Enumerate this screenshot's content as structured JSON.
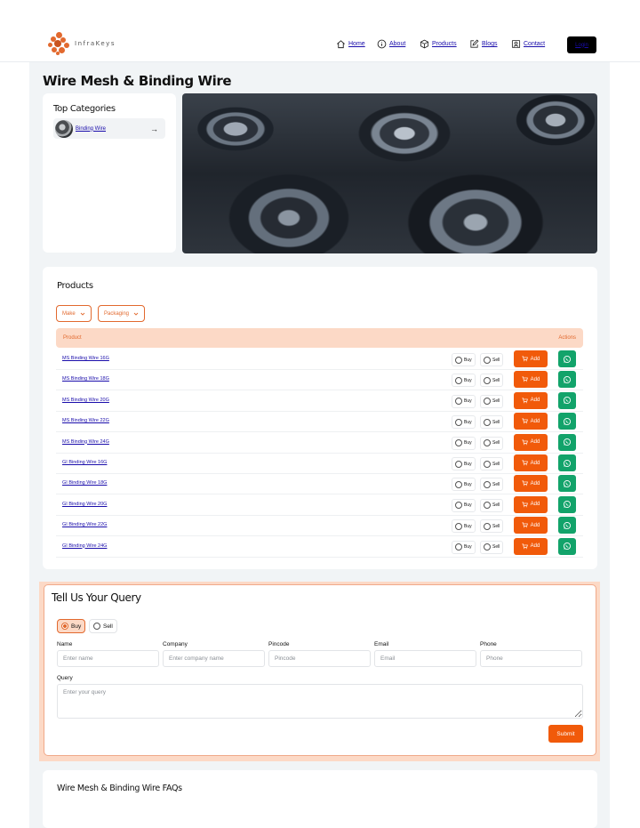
{
  "header": {
    "logo_text": "InfraKeys",
    "nav": [
      {
        "label": "Home",
        "icon": "home-icon"
      },
      {
        "label": "About",
        "icon": "info-icon"
      },
      {
        "label": "Products",
        "icon": "box-icon"
      },
      {
        "label": "Blogs",
        "icon": "edit-icon"
      },
      {
        "label": "Contact",
        "icon": "contact-icon"
      }
    ],
    "login_label": "Login"
  },
  "page": {
    "title": "Wire Mesh & Binding Wire"
  },
  "categories": {
    "title": "Top Categories",
    "items": [
      {
        "label": "Binding Wire"
      }
    ]
  },
  "products": {
    "title": "Products",
    "filters": [
      "Make",
      "Packaging"
    ],
    "columns": {
      "product": "Product",
      "actions": "Actions"
    },
    "buy_label": "Buy",
    "sell_label": "Sell",
    "add_label": "Add",
    "rows": [
      "MS Binding Wire 16G",
      "MS Binding Wire 18G",
      "MS Binding Wire 20G",
      "MS Binding Wire 22G",
      "MS Binding Wire 24G",
      "GI Binding Wire 16G",
      "GI Binding Wire 18G",
      "GI Binding Wire 20G",
      "GI Binding Wire 22G",
      "GI Binding Wire 24G"
    ]
  },
  "query": {
    "title": "Tell Us Your Query",
    "mode_options": [
      "Buy",
      "Sell"
    ],
    "selected_mode": "Buy",
    "fields": {
      "name": {
        "label": "Name",
        "placeholder": "Enter name"
      },
      "company": {
        "label": "Company",
        "placeholder": "Enter company name"
      },
      "pincode": {
        "label": "Pincode",
        "placeholder": "Pincode"
      },
      "email": {
        "label": "Email",
        "placeholder": "Email"
      },
      "phone": {
        "label": "Phone",
        "placeholder": "Phone"
      },
      "query": {
        "label": "Query",
        "placeholder": "Enter your query"
      }
    },
    "submit_label": "Submit"
  },
  "faq": {
    "title": "Wire Mesh & Binding Wire FAQs"
  },
  "colors": {
    "accent": "#f15a0a",
    "accent_light": "#fcd9c6",
    "whatsapp": "#12a36a",
    "link": "#1a0dab",
    "page_bg": "#f1f4f6"
  }
}
